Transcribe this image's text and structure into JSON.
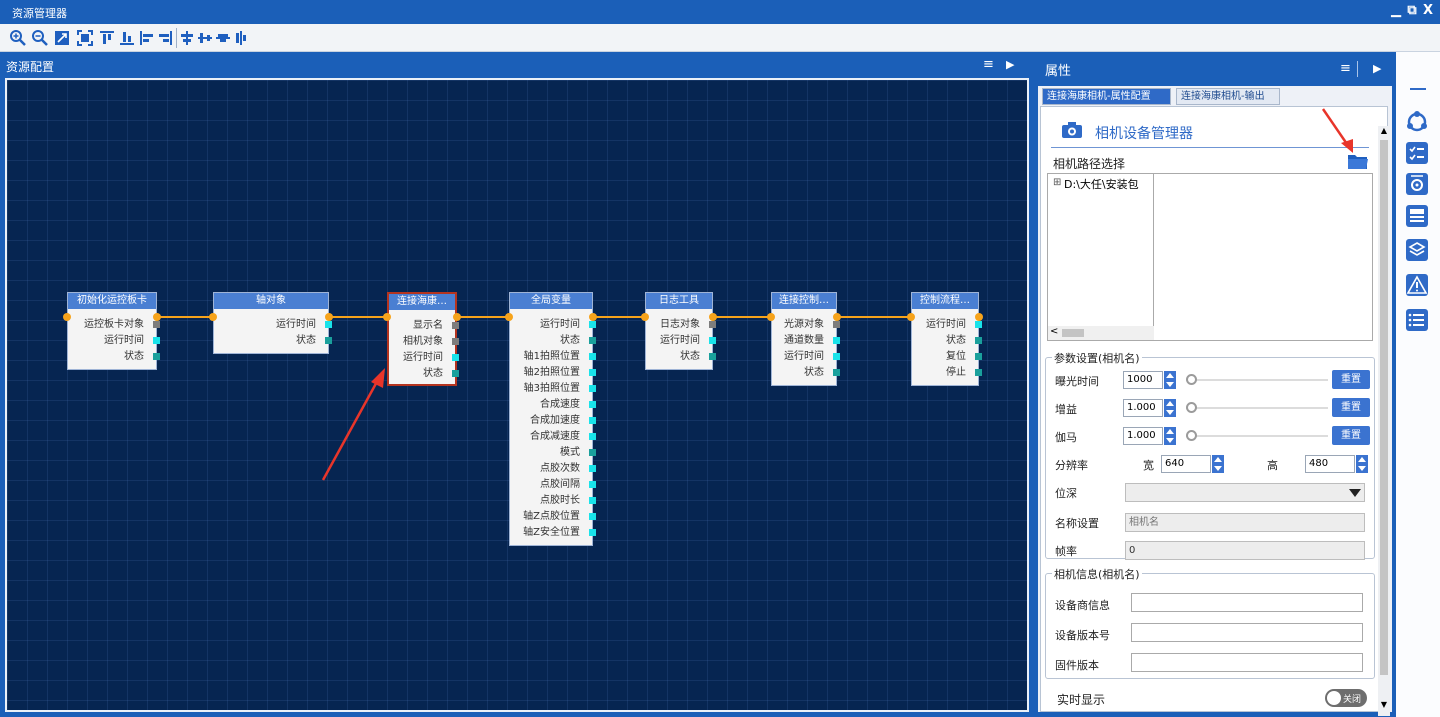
{
  "window": {
    "title": "资源管理器",
    "controls": [
      "▁",
      "⧉",
      "X"
    ]
  },
  "toolbar": {
    "icons": [
      "zoom-in-icon",
      "zoom-out-icon",
      "fit-window-icon",
      "fit-selection-icon",
      "align-top-icon",
      "align-bottom-icon",
      "align-left-icon",
      "align-right-icon",
      "align-center-horizontal-icon",
      "distribute-horizontal-icon",
      "align-center-vertical-icon",
      "distribute-vertical-icon"
    ]
  },
  "left_panel": {
    "title": "资源配置",
    "menu_icon": "≡",
    "pin_icon": "▶"
  },
  "nodes": [
    {
      "title": "初始化运控板卡",
      "ports": [
        {
          "label": "运控板卡对象",
          "color": "gray"
        },
        {
          "label": "运行时间",
          "color": "cyan"
        },
        {
          "label": "状态",
          "color": "teal"
        }
      ]
    },
    {
      "title": "轴对象",
      "ports": [
        {
          "label": "运行时间",
          "color": "cyan"
        },
        {
          "label": "状态",
          "color": "teal"
        }
      ]
    },
    {
      "title": "连接海康…",
      "ports": [
        {
          "label": "显示名",
          "color": "gray"
        },
        {
          "label": "相机对象",
          "color": "gray"
        },
        {
          "label": "运行时间",
          "color": "cyan"
        },
        {
          "label": "状态",
          "color": "teal"
        }
      ]
    },
    {
      "title": "全局变量",
      "ports": [
        {
          "label": "运行时间",
          "color": "cyan"
        },
        {
          "label": "状态",
          "color": "teal"
        },
        {
          "label": "轴1拍照位置",
          "color": "cyan"
        },
        {
          "label": "轴2拍照位置",
          "color": "cyan"
        },
        {
          "label": "轴3拍照位置",
          "color": "cyan"
        },
        {
          "label": "合成速度",
          "color": "cyan"
        },
        {
          "label": "合成加速度",
          "color": "cyan"
        },
        {
          "label": "合成减速度",
          "color": "cyan"
        },
        {
          "label": "模式",
          "color": "teal"
        },
        {
          "label": "点胶次数",
          "color": "cyan"
        },
        {
          "label": "点胶间隔",
          "color": "cyan"
        },
        {
          "label": "点胶时长",
          "color": "cyan"
        },
        {
          "label": "轴Z点胶位置",
          "color": "cyan"
        },
        {
          "label": "轴Z安全位置",
          "color": "cyan"
        }
      ]
    },
    {
      "title": "日志工具",
      "ports": [
        {
          "label": "日志对象",
          "color": "gray"
        },
        {
          "label": "运行时间",
          "color": "cyan"
        },
        {
          "label": "状态",
          "color": "teal"
        }
      ]
    },
    {
      "title": "连接控制…",
      "ports": [
        {
          "label": "光源对象",
          "color": "gray"
        },
        {
          "label": "通道数量",
          "color": "cyan"
        },
        {
          "label": "运行时间",
          "color": "cyan"
        },
        {
          "label": "状态",
          "color": "teal"
        }
      ]
    },
    {
      "title": "控制流程…",
      "ports": [
        {
          "label": "运行时间",
          "color": "cyan"
        },
        {
          "label": "状态",
          "color": "teal"
        },
        {
          "label": "复位",
          "color": "teal"
        },
        {
          "label": "停止",
          "color": "teal"
        }
      ]
    }
  ],
  "properties": {
    "title": "属性",
    "menu_icon": "≡",
    "pin_icon": "▶",
    "close_icon": "X",
    "tabs": [
      {
        "label": "连接海康相机-属性配置",
        "active": true
      },
      {
        "label": "连接海康相机-输出",
        "active": false
      }
    ],
    "header": "相机设备管理器",
    "path_label": "相机路径选择",
    "tree_item": "D:\\大任\\安装包",
    "tree_expander": "⊞",
    "hscroll_left": "<",
    "params_group": "参数设置(相机名)",
    "exposure_label": "曝光时间",
    "exposure_value": "1000",
    "exposure_level": 0,
    "gain_label": "增益",
    "gain_value": "1.000",
    "gain_level": 0,
    "gamma_label": "伽马",
    "gamma_value": "1.000",
    "gamma_level": 0,
    "reset_label": "重置",
    "resolution_label": "分辨率",
    "width_label": "宽",
    "width_value": "640",
    "height_label": "高",
    "height_value": "480",
    "bitdepth_label": "位深",
    "bitdepth_value": "",
    "name_label": "名称设置",
    "name_value": "相机名",
    "fps_label": "帧率",
    "fps_value": "0",
    "info_group": "相机信息(相机名)",
    "vendor_label": "设备商信息",
    "vendor_value": "",
    "version_label": "设备版本号",
    "version_value": "",
    "firmware_label": "固件版本",
    "firmware_value": "",
    "realtime_label": "实时显示",
    "realtime_toggle": "关闭"
  },
  "sidebar": {
    "collapse": "—",
    "icons": [
      "network-icon",
      "checklist-icon",
      "settings-list-icon",
      "layout-icon",
      "layers-icon",
      "warning-icon",
      "list-detail-icon"
    ]
  },
  "colors": {
    "brand": "#1b5fb8",
    "canvas": "#062551",
    "node_header": "#4a7fd2",
    "connector": "#f6a31b",
    "selected_border": "#b4341f",
    "annotation_arrow": "#e8352a"
  }
}
